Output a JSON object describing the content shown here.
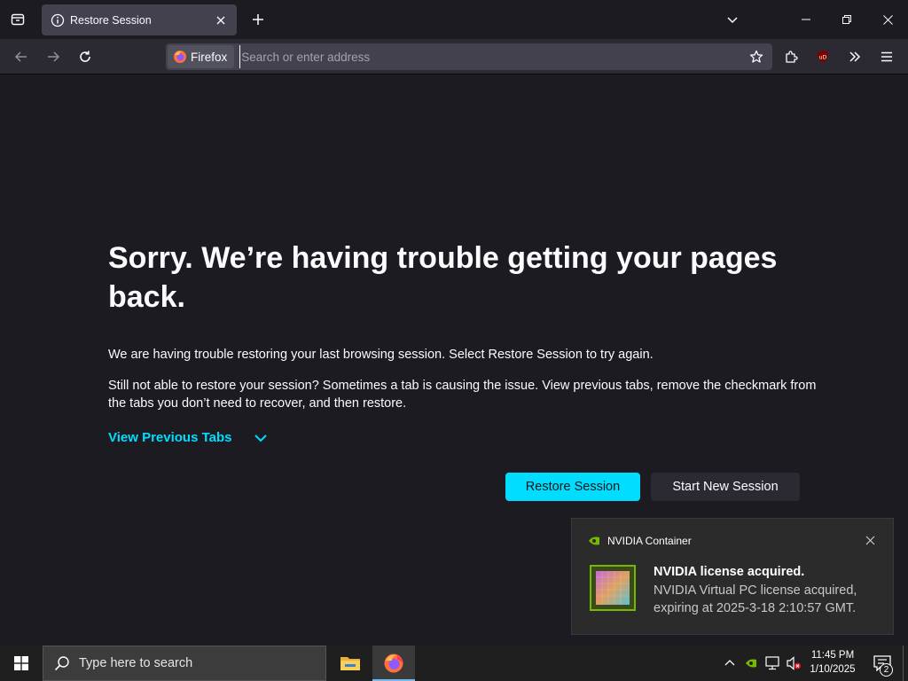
{
  "browser": {
    "tab": {
      "title": "Restore Session"
    },
    "identity_label": "Firefox",
    "url": {
      "placeholder": "Search or enter address",
      "value": ""
    }
  },
  "error_page": {
    "title": "Sorry. We’re having trouble getting your pages back.",
    "paragraph1": "We are having trouble restoring your last browsing session. Select Restore Session to try again.",
    "paragraph2": "Still not able to restore your session? Sometimes a tab is causing the issue. View previous tabs, remove the checkmark from the tabs you don’t need to recover, and then restore.",
    "view_previous_tabs": "View Previous Tabs",
    "restore_button": "Restore Session",
    "new_session_button": "Start New Session"
  },
  "notification": {
    "app_name": "NVIDIA Container",
    "title": "NVIDIA license acquired.",
    "body": "NVIDIA Virtual PC license acquired, expiring at 2025-3-18 2:10:57 GMT."
  },
  "taskbar": {
    "search_placeholder": "Type here to search",
    "time": "11:45 PM",
    "date": "1/10/2025",
    "notification_count": "2"
  },
  "colors": {
    "accent": "#00ddff",
    "page_bg": "#1c1b22",
    "toolbar_bg": "#2b2a33",
    "field_bg": "#42414d"
  }
}
